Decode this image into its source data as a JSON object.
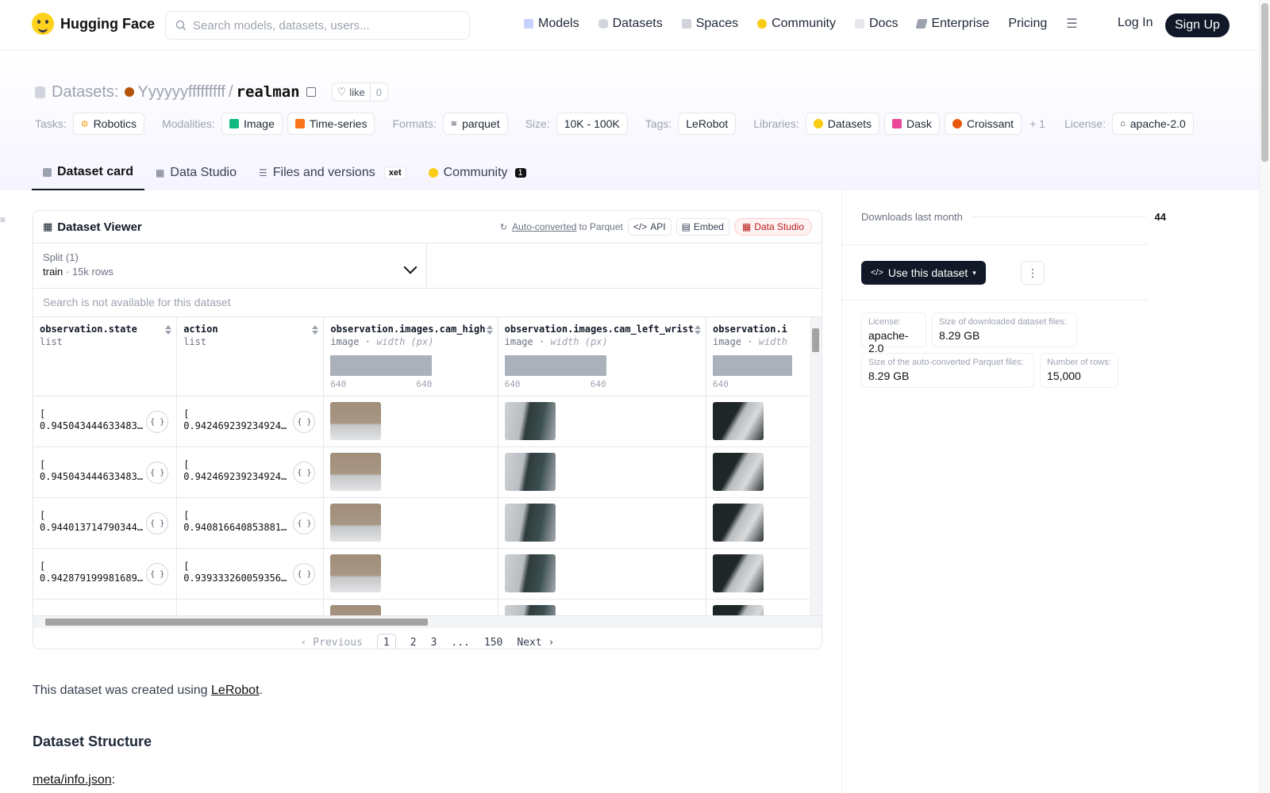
{
  "nav": {
    "brand": "Hugging Face",
    "search_placeholder": "Search models, datasets, users...",
    "links": [
      "Models",
      "Datasets",
      "Spaces",
      "Community",
      "Docs",
      "Enterprise",
      "Pricing"
    ],
    "login": "Log In",
    "signup": "Sign Up"
  },
  "repo": {
    "type_label": "Datasets:",
    "owner": "Yyyyyyfffffffff",
    "separator": "/",
    "name": "realman",
    "like_label": "like",
    "like_count": "0"
  },
  "tags": {
    "tasks_label": "Tasks:",
    "tasks": [
      "Robotics"
    ],
    "modalities_label": "Modalities:",
    "modalities": [
      "Image",
      "Time-series"
    ],
    "formats_label": "Formats:",
    "formats": [
      "parquet"
    ],
    "size_label": "Size:",
    "size": "10K - 100K",
    "tags_label": "Tags:",
    "tags": [
      "LeRobot"
    ],
    "libraries_label": "Libraries:",
    "libraries": [
      "Datasets",
      "Dask",
      "Croissant"
    ],
    "libraries_more": "+ 1",
    "license_label": "License:",
    "license": "apache-2.0"
  },
  "tabs": [
    {
      "label": "Dataset card",
      "active": true
    },
    {
      "label": "Data Studio"
    },
    {
      "label": "Files and versions",
      "badge": "xet"
    },
    {
      "label": "Community",
      "count": "1"
    }
  ],
  "viewer": {
    "title": "Dataset Viewer",
    "auto_converted": "Auto-converted",
    "to_parquet": "to Parquet",
    "api": "API",
    "embed": "Embed",
    "data_studio": "Data Studio",
    "split_label": "Split (1)",
    "split_name": "train",
    "split_rows": "15k rows",
    "search_na": "Search is not available for this dataset",
    "columns": [
      {
        "name": "observation.state",
        "type": "list"
      },
      {
        "name": "action",
        "type": "list"
      },
      {
        "name": "observation.images.cam_high",
        "type": "image",
        "subtype": "width (px)",
        "min": "640",
        "max": "640"
      },
      {
        "name": "observation.images.cam_left_wrist",
        "type": "image",
        "subtype": "width (px)",
        "min": "640",
        "max": "640"
      },
      {
        "name": "observation.i",
        "type": "image",
        "subtype": "width",
        "min": "640",
        "max": ""
      }
    ],
    "rows": [
      {
        "state": "0.9450434446334839…",
        "action": "0.9424692392349243,…"
      },
      {
        "state": "0.9450434446334839…",
        "action": "0.9424692392349243,…"
      },
      {
        "state": "0.9440137147903442…",
        "action": "0.9408166408538818,…"
      },
      {
        "state": "0.9428791999816895…",
        "action": "0.9393332600593567,…"
      }
    ],
    "list_open": "[",
    "json_icon": "{ }",
    "pager": {
      "prev": "Previous",
      "pages": [
        "1",
        "2",
        "3",
        "...",
        "150"
      ],
      "next": "Next"
    }
  },
  "card": {
    "intro_before": "This dataset was created using ",
    "intro_link": "LeRobot",
    "intro_after": ".",
    "section_title": "Dataset Structure",
    "meta_link": "meta/info.json",
    "meta_after": ":"
  },
  "sidebar": {
    "downloads_label": "Downloads last month",
    "downloads": "44",
    "use_button": "Use this dataset",
    "stats": [
      {
        "k": "License:",
        "v": "apache-2.0"
      },
      {
        "k": "Size of downloaded dataset files:",
        "v": "8.29 GB"
      },
      {
        "k": "Size of the auto-converted Parquet files:",
        "v": "8.29 GB"
      },
      {
        "k": "Number of rows:",
        "v": "15,000"
      }
    ]
  },
  "colors": {
    "accent_dark": "#111827",
    "brand_yellow": "#ffd21e"
  }
}
